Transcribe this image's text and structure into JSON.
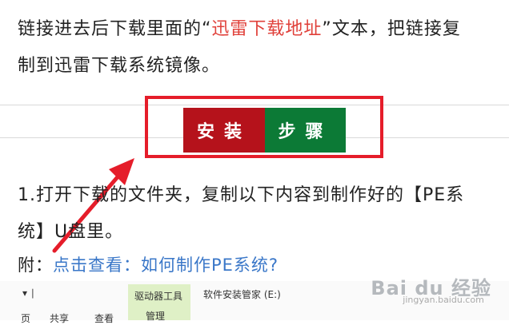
{
  "article": {
    "line1_pre": "链接进去后下载里面的“",
    "line1_highlight": "迅雷下载地址",
    "line1_post": "”文本，把链接复",
    "line2": "制到迅雷下载系统镜像。",
    "step_title": {
      "left": "安装",
      "right": "步骤"
    },
    "line3": "1.打开下载的文件夹，复制以下内容到制作好的【PE系",
    "line4": "统】U盘里。",
    "line5_prefix": "附：",
    "line5_link": "点击查看：如何制作PE系统?"
  },
  "explorer": {
    "tool_tab": "驱动器工具",
    "window_title": "软件安装管家 (E:)",
    "menu_manage": "管理",
    "menu_share": "共享",
    "menu_view": "查看",
    "menu_left": "页",
    "quick_mark": "▾ ∣"
  },
  "watermark": {
    "brand": "Bai du 经验",
    "sub": "jingyan.baidu.com"
  },
  "colors": {
    "install_bg": "#b5121b",
    "steps_bg": "#0c7a36",
    "highlight": "#e51d2a",
    "link": "#3a77c8"
  }
}
